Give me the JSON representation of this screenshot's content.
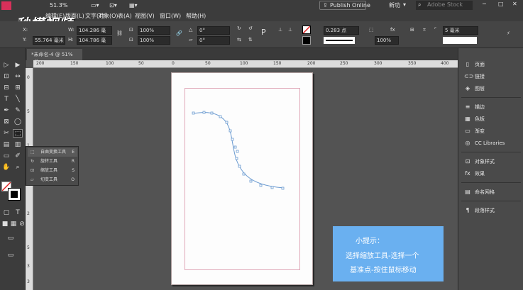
{
  "menubar": {
    "zoom": "51.3%",
    "items": [
      "编辑(E)",
      "版面(L)",
      "文字(T)",
      "对象(O)",
      "表(A)",
      "视图(V)",
      "窗口(W)",
      "帮助(H)"
    ],
    "publish_label": "Publish Online",
    "workspace_label": "新功",
    "search_placeholder": "Adobe Stock"
  },
  "watermark": "秒懂视频",
  "controlbar": {
    "x_label": "X:",
    "y_label": "Y:",
    "y_value": "55.764 毫米",
    "w_label": "W:",
    "w_value": "104.286 毫",
    "h_label": "H:",
    "h_value": "104.786 毫",
    "scale_x": "100%",
    "scale_y": "100%",
    "angle_1": "0°",
    "angle_2": "0°",
    "stroke_weight": "0.283 点",
    "opacity": "100%",
    "size_value": "5 毫米"
  },
  "tab": {
    "title": "*未命名-4 @ 51%",
    "close": "×"
  },
  "ruler_h": [
    "200",
    "150",
    "100",
    "50",
    "0",
    "50",
    "100",
    "150",
    "200",
    "250",
    "300",
    "350",
    "400"
  ],
  "ruler_v": [
    "0",
    "5",
    "1",
    "5",
    "2",
    "5",
    "3",
    "3"
  ],
  "flyout": {
    "items": [
      {
        "label": "自由变换工具",
        "key": "E"
      },
      {
        "label": "旋转工具",
        "key": "R"
      },
      {
        "label": "缩放工具",
        "key": "S"
      },
      {
        "label": "切变工具",
        "key": "O"
      }
    ]
  },
  "panel": {
    "items": [
      {
        "label": "页面",
        "icon": "pages-icon"
      },
      {
        "label": "链接",
        "icon": "links-icon"
      },
      {
        "label": "图层",
        "icon": "layers-icon"
      },
      {
        "label": "描边",
        "icon": "stroke-icon"
      },
      {
        "label": "色板",
        "icon": "swatches-icon"
      },
      {
        "label": "渐变",
        "icon": "gradient-icon"
      },
      {
        "label": "CC Libraries",
        "icon": "cc-libraries-icon"
      },
      {
        "label": "对象样式",
        "icon": "object-styles-icon"
      },
      {
        "label": "效果",
        "icon": "effects-icon"
      },
      {
        "label": "命名网格",
        "icon": "named-grids-icon"
      },
      {
        "label": "段落样式",
        "icon": "paragraph-styles-icon"
      }
    ]
  },
  "tip": {
    "line1": "小提示：",
    "line2": "选择缩放工具-选择一个",
    "line3": "基准点-按住鼠标移动"
  },
  "colors": {
    "tip_bg": "#6ab0f0",
    "path_stroke": "#6a9ad0",
    "margin_guide": "#e0a8b8"
  }
}
